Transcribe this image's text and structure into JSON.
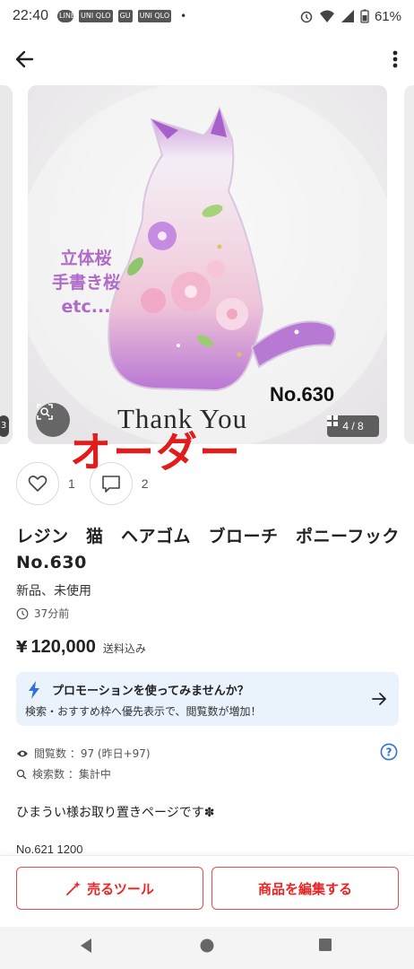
{
  "status": {
    "time": "22:40",
    "apps": [
      "LINE",
      "UNI QLO",
      "GU",
      "UNI QLO"
    ],
    "more_dot": "•",
    "battery": "61%"
  },
  "appbar": {
    "back_icon": "arrow-left-icon",
    "more_icon": "more-vertical-icon"
  },
  "carousel": {
    "peek_left_badge": "3",
    "image_text": {
      "sakura_lines": [
        "立体桜",
        "手書き桜",
        "etc..."
      ],
      "product_no": "No.630",
      "thanks": "Thank You"
    },
    "page_indicator": "4 / 8",
    "lens_icon": "image-search-icon"
  },
  "overlay": {
    "order": "オーダー"
  },
  "reactions": {
    "like_count": "1",
    "comment_count": "2"
  },
  "product": {
    "title": "レジン　猫　ヘアゴム　ブローチ　ポニーフック　No.630",
    "condition": "新品、未使用",
    "posted": "37分前",
    "price_symbol": "¥",
    "price": "120,000",
    "shipping": "送料込み"
  },
  "promo": {
    "title": "プロモーションを使ってみませんか？",
    "subtitle": "検索・おすすめ枠へ優先表示で、閲覧数が増加！"
  },
  "stats": {
    "views": "閲覧数 ：97 (昨日+97)",
    "searches": "検索数 ：集計中"
  },
  "description": {
    "line1": "ひまうい様お取り置きページです✽",
    "line2": "No.621   1200"
  },
  "actions": {
    "sell_tool": "売るツール",
    "edit": "商品を編集する"
  },
  "colors": {
    "accent_red": "#e22222",
    "promo_bg": "#eaf2fc",
    "promo_bolt": "#2f6fd6"
  }
}
